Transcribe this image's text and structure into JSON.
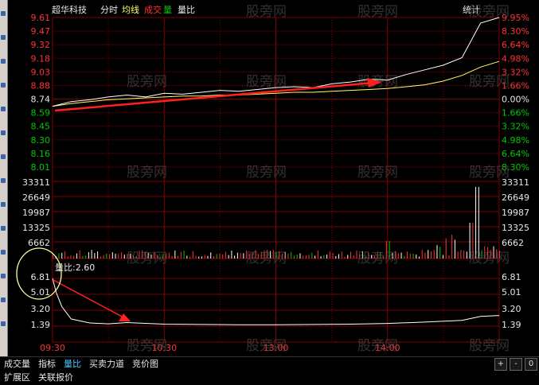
{
  "stock": {
    "name": "超华科技"
  },
  "legend": {
    "fenshi": "分时",
    "junxian": "均线",
    "chengjiao": "成交",
    "liang": "量",
    "liangbi": "量比"
  },
  "top_right": "统计",
  "price_axis": {
    "left": [
      "9.61",
      "9.47",
      "9.32",
      "9.18",
      "9.03",
      "8.88",
      "8.74",
      "8.59",
      "8.45",
      "8.30",
      "8.16",
      "8.01"
    ],
    "right": [
      "9.95%",
      "8.30%",
      "6.64%",
      "4.98%",
      "3.32%",
      "1.66%",
      "0.00%",
      "1.66%",
      "3.32%",
      "4.98%",
      "6.64%",
      "8.30%"
    ]
  },
  "volume_axis": {
    "labels": [
      "33311",
      "26649",
      "19987",
      "13325",
      "6662"
    ]
  },
  "ratio_panel": {
    "title": "量比:2.60",
    "labels": [
      "6.81",
      "5.01",
      "3.20",
      "1.39"
    ]
  },
  "time_axis": [
    "09:30",
    "10:30",
    "13:00",
    "14:00"
  ],
  "watermark": "股旁网",
  "tabs": [
    "成交量",
    "指标",
    "量比",
    "买卖力道",
    "竞价图"
  ],
  "active_tab": "量比",
  "extra_tabs": [
    "扩展区",
    "关联报价"
  ],
  "mini_buttons": [
    "+",
    "-",
    "0"
  ],
  "colors": {
    "up": "#ff3232",
    "down": "#00c800",
    "grid": "#800000",
    "price": "#ffffff",
    "avg": "#ffff66",
    "accent": "#4fc3f7",
    "annotation": "#ff2020",
    "circle": "#ffff99"
  },
  "chart_data": {
    "type": "line",
    "price": {
      "ylim": [
        8.01,
        9.61
      ],
      "x": [
        0,
        10,
        20,
        30,
        40,
        50,
        60,
        70,
        80,
        90,
        100,
        110,
        120,
        130,
        140,
        150,
        160,
        170,
        180,
        190,
        200,
        210,
        220,
        230,
        240
      ],
      "series": [
        {
          "values": [
            8.66,
            8.71,
            8.73,
            8.76,
            8.78,
            8.76,
            8.8,
            8.79,
            8.81,
            8.83,
            8.82,
            8.84,
            8.86,
            8.87,
            8.86,
            8.9,
            8.92,
            8.95,
            8.94,
            9.0,
            9.05,
            9.1,
            9.18,
            9.55,
            9.61
          ]
        },
        {
          "values": [
            8.66,
            8.69,
            8.71,
            8.73,
            8.74,
            8.75,
            8.76,
            8.77,
            8.77,
            8.78,
            8.78,
            8.79,
            8.8,
            8.81,
            8.81,
            8.82,
            8.83,
            8.84,
            8.85,
            8.87,
            8.89,
            8.93,
            8.99,
            9.08,
            9.14
          ]
        }
      ]
    },
    "volume": {
      "ylim": [
        0,
        33311
      ]
    },
    "ratio": {
      "ylim": [
        1.39,
        6.81
      ],
      "x": [
        0,
        2,
        5,
        10,
        20,
        30,
        40,
        60,
        80,
        100,
        120,
        140,
        160,
        180,
        200,
        220,
        230,
        240
      ],
      "values": [
        6.81,
        5.2,
        3.6,
        2.2,
        1.75,
        1.65,
        1.8,
        1.62,
        1.58,
        1.55,
        1.55,
        1.58,
        1.62,
        1.7,
        1.85,
        2.05,
        2.5,
        2.6
      ]
    }
  }
}
